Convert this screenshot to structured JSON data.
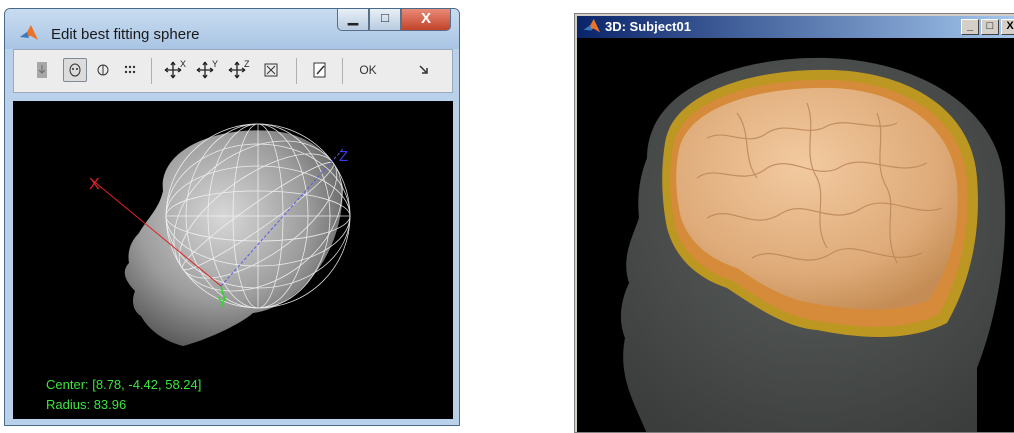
{
  "window1": {
    "title": "Edit best fitting sphere",
    "controls": {
      "minimize": "▁",
      "maximize": "□",
      "close": "X"
    },
    "toolbar": {
      "ok_label": "OK",
      "axis_labels": {
        "x": "X",
        "y": "Y",
        "z": "Z"
      }
    },
    "axes": {
      "x_label": "X",
      "y_label": "Y",
      "z_label": "Z"
    },
    "center_text": "Center: [8.78, -4.42, 58.24]",
    "radius_text": "Radius: 83.96",
    "colors": {
      "axis_x": "#e02020",
      "axis_y": "#22dd22",
      "axis_z": "#2a2aee",
      "info_text": "#3de53d"
    }
  },
  "window2": {
    "title": "3D: Subject01",
    "controls": {
      "minimize": "_",
      "maximize": "□",
      "close": "X"
    },
    "colors": {
      "head": "#4a4e4c",
      "skull": "#c9a01d",
      "brain": "#e8b88a"
    }
  }
}
